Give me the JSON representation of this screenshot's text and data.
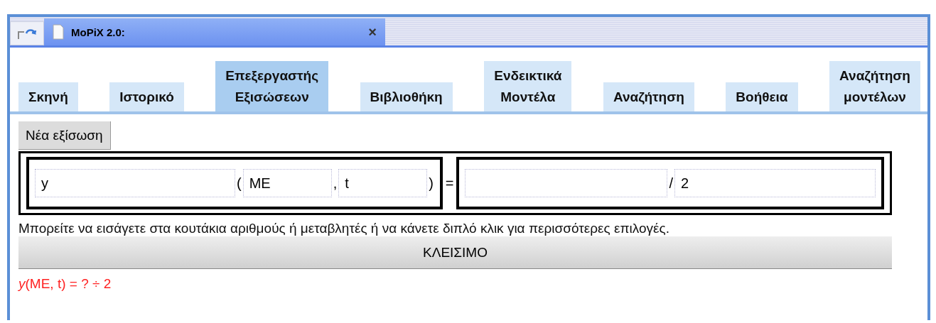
{
  "browser_tab": {
    "title": "MoPiX 2.0:",
    "close": "×"
  },
  "tabs": [
    {
      "label": "Σκηνή",
      "selected": false
    },
    {
      "label": "Ιστορικό",
      "selected": false
    },
    {
      "label": "Επεξεργαστής\nΕξισώσεων",
      "selected": true
    },
    {
      "label": "Βιβλιοθήκη",
      "selected": false
    },
    {
      "label": "Ενδεικτικά\nΜοντέλα",
      "selected": false
    },
    {
      "label": "Αναζήτηση",
      "selected": false
    },
    {
      "label": "Βοήθεια",
      "selected": false
    },
    {
      "label": "Αναζήτηση\nμοντέλων",
      "selected": false
    }
  ],
  "new_equation_button": "Νέα εξίσωση",
  "equation": {
    "left": [
      {
        "kind": "field",
        "value": "y"
      },
      {
        "kind": "symbol",
        "text": "("
      },
      {
        "kind": "field",
        "value": "ME"
      },
      {
        "kind": "symbol",
        "text": ","
      },
      {
        "kind": "field",
        "value": "t"
      },
      {
        "kind": "symbol",
        "text": ")"
      }
    ],
    "equals": "=",
    "right": [
      {
        "kind": "field"
      },
      {
        "kind": "symbol",
        "text": "/"
      },
      {
        "kind": "field",
        "value": "2"
      }
    ]
  },
  "hint": "Μπορείτε να εισάγετε στα κουτάκια αριθμούς ή μεταβλητές ή να κάνετε διπλό κλικ για περισσότερες επιλογές.",
  "close_button": "ΚΛΕΙΣΙΜΟ",
  "result": "*y*(ME, t) = ? ÷ 2"
}
